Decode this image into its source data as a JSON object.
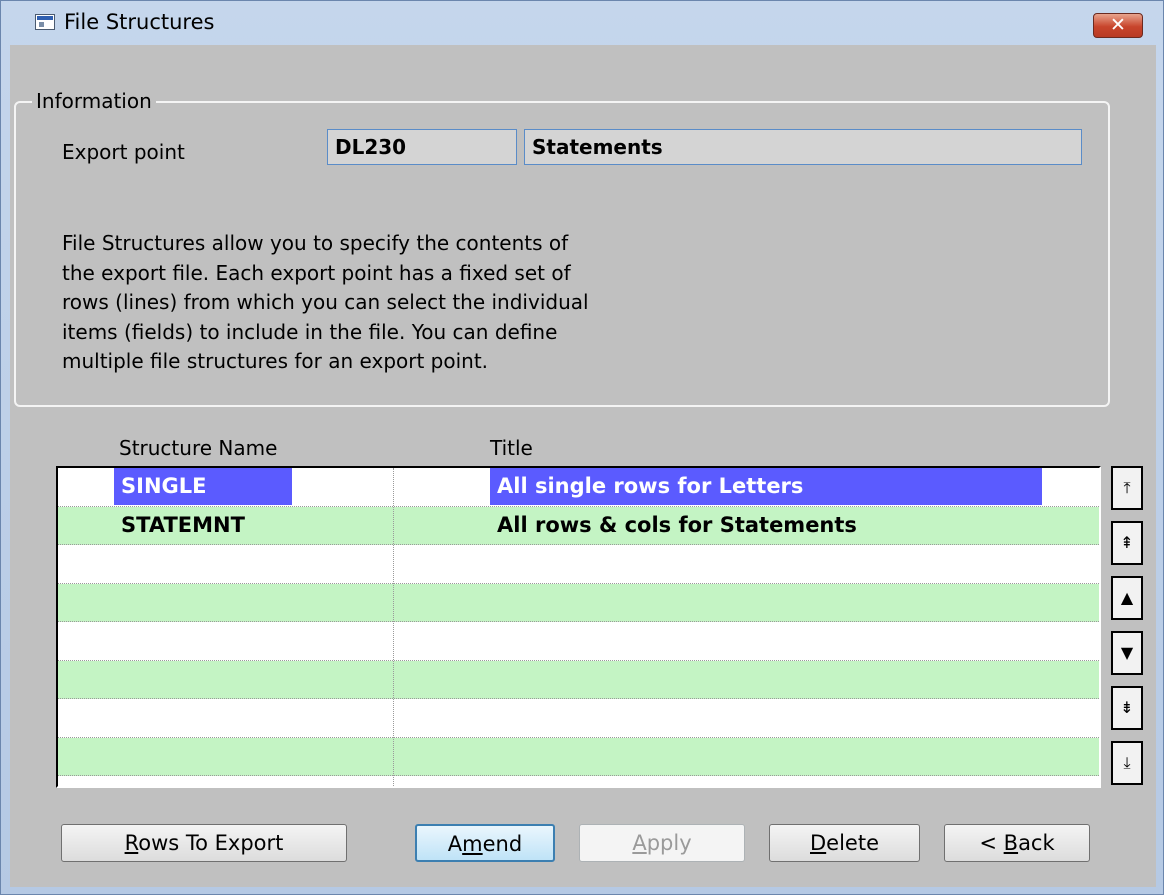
{
  "window": {
    "title": "File Structures",
    "close_glyph": "✕"
  },
  "info": {
    "legend": "Information",
    "export_point_label": "Export point",
    "export_point_code": "DL230",
    "export_point_name": "Statements",
    "description": [
      "File Structures allow you to specify the contents of",
      "the export file.  Each export point has a fixed set of",
      "rows (lines) from which you can select the individual",
      "items (fields) to include in the file.  You can define",
      "multiple file structures for an export point."
    ]
  },
  "list": {
    "headers": {
      "name": "Structure Name",
      "title": "Title"
    },
    "rows": [
      {
        "name": "SINGLE",
        "title": "All single rows for Letters",
        "selected": true
      },
      {
        "name": "STATEMNT",
        "title": "All rows & cols for Statements",
        "selected": false
      },
      {
        "name": "",
        "title": ""
      },
      {
        "name": "",
        "title": ""
      },
      {
        "name": "",
        "title": ""
      },
      {
        "name": "",
        "title": ""
      },
      {
        "name": "",
        "title": ""
      },
      {
        "name": "",
        "title": ""
      }
    ],
    "row_colors": {
      "odd": "#ffffff",
      "even": "#c4f4c4",
      "selected": "#5b5bff"
    }
  },
  "scroll_buttons": [
    {
      "name": "scroll-top-icon",
      "glyph": "⤒"
    },
    {
      "name": "scroll-page-up-icon",
      "glyph": "⇞"
    },
    {
      "name": "scroll-up-icon",
      "glyph": "▲"
    },
    {
      "name": "scroll-down-icon",
      "glyph": "▼"
    },
    {
      "name": "scroll-page-down-icon",
      "glyph": "⇟"
    },
    {
      "name": "scroll-bottom-icon",
      "glyph": "⤓"
    }
  ],
  "buttons": {
    "rows_to_export": {
      "pre": "",
      "key": "R",
      "post": "ows To Export"
    },
    "amend": {
      "pre": "A",
      "key": "m",
      "post": "end"
    },
    "apply": {
      "pre": "",
      "key": "A",
      "post": "pply"
    },
    "delete": {
      "pre": "",
      "key": "D",
      "post": "elete"
    },
    "back": {
      "pre": "< ",
      "key": "B",
      "post": "ack"
    }
  }
}
